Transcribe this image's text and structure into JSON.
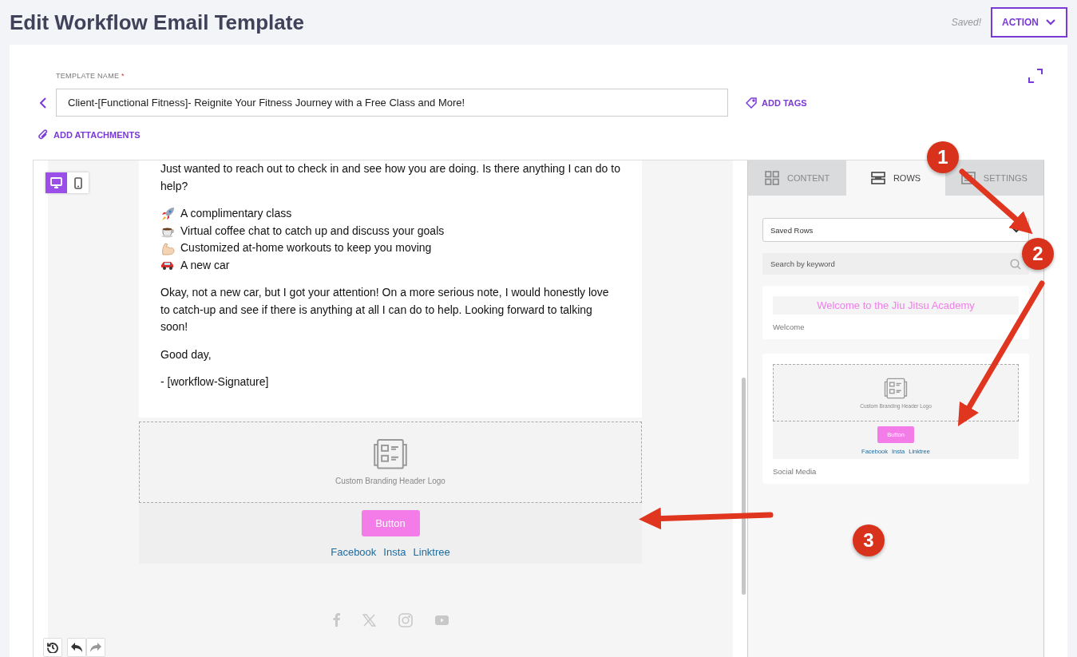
{
  "page": {
    "title": "Edit Workflow Email Template",
    "save_status": "Saved!",
    "action_button": "ACTION"
  },
  "template_name": {
    "label": "TEMPLATE NAME",
    "required_mark": "*",
    "value": "Client-[Functional Fitness]- Reignite Your Fitness Journey with a Free Class and More!"
  },
  "add_tags": "ADD TAGS",
  "add_attachments": "ADD ATTACHMENTS",
  "preview_modes": [
    {
      "kind": "desktop",
      "selected": true
    },
    {
      "kind": "mobile",
      "selected": false
    }
  ],
  "email": {
    "blocks": [
      {
        "kind": "paragraph",
        "text": "Just wanted to reach out to check in and see how you are doing. Is there anything I can do to help?"
      },
      {
        "kind": "list",
        "items": [
          {
            "kind": "rocket",
            "text": "A complimentary class"
          },
          {
            "kind": "coffee",
            "text": "Virtual coffee chat to catch up and discuss your goals"
          },
          {
            "kind": "arm",
            "text": "Customized at-home workouts to keep you moving"
          },
          {
            "kind": "car",
            "text": "A new car"
          }
        ]
      },
      {
        "kind": "paragraph",
        "text": "Okay, not a new car, but I got your attention! On a more serious note, I would honestly love to catch-up and see if there is anything at all I can do to help. Looking forward to talking soon!"
      },
      {
        "kind": "paragraph",
        "text": "Good day,"
      },
      {
        "kind": "paragraph",
        "text": "- [workflow-Signature]"
      }
    ],
    "branding": {
      "logo_caption": "Custom Branding Header Logo",
      "button": "Button",
      "links": [
        "Facebook",
        "Insta",
        "Linktree"
      ]
    },
    "social_icons": [
      {
        "kind": "facebook"
      },
      {
        "kind": "x"
      },
      {
        "kind": "instagram"
      },
      {
        "kind": "youtube"
      }
    ]
  },
  "history_tools": [
    {
      "kind": "history",
      "disabled": false
    },
    {
      "kind": "undo",
      "disabled": false
    },
    {
      "kind": "redo",
      "disabled": true
    }
  ],
  "panel": {
    "tabs": [
      {
        "kind": "grid",
        "label": "CONTENT",
        "selected": false
      },
      {
        "kind": "rows",
        "label": "ROWS",
        "selected": true
      },
      {
        "kind": "settings",
        "label": "SETTINGS",
        "selected": false
      }
    ],
    "dropdown": {
      "value": "Saved Rows"
    },
    "search": {
      "placeholder": "Search by keyword"
    },
    "saved_rows": [
      {
        "kind": "heading",
        "preview_text": "Welcome to the Jiu Jitsu Academy",
        "name": "Welcome"
      },
      {
        "kind": "branding",
        "logo_caption": "Custom Branding Header Logo",
        "button": "Button",
        "links": [
          "Facebook",
          "Insta",
          "Linktree"
        ],
        "name": "Social Media"
      }
    ]
  },
  "annotations": [
    {
      "label": "1"
    },
    {
      "label": "2"
    },
    {
      "label": "3"
    }
  ]
}
